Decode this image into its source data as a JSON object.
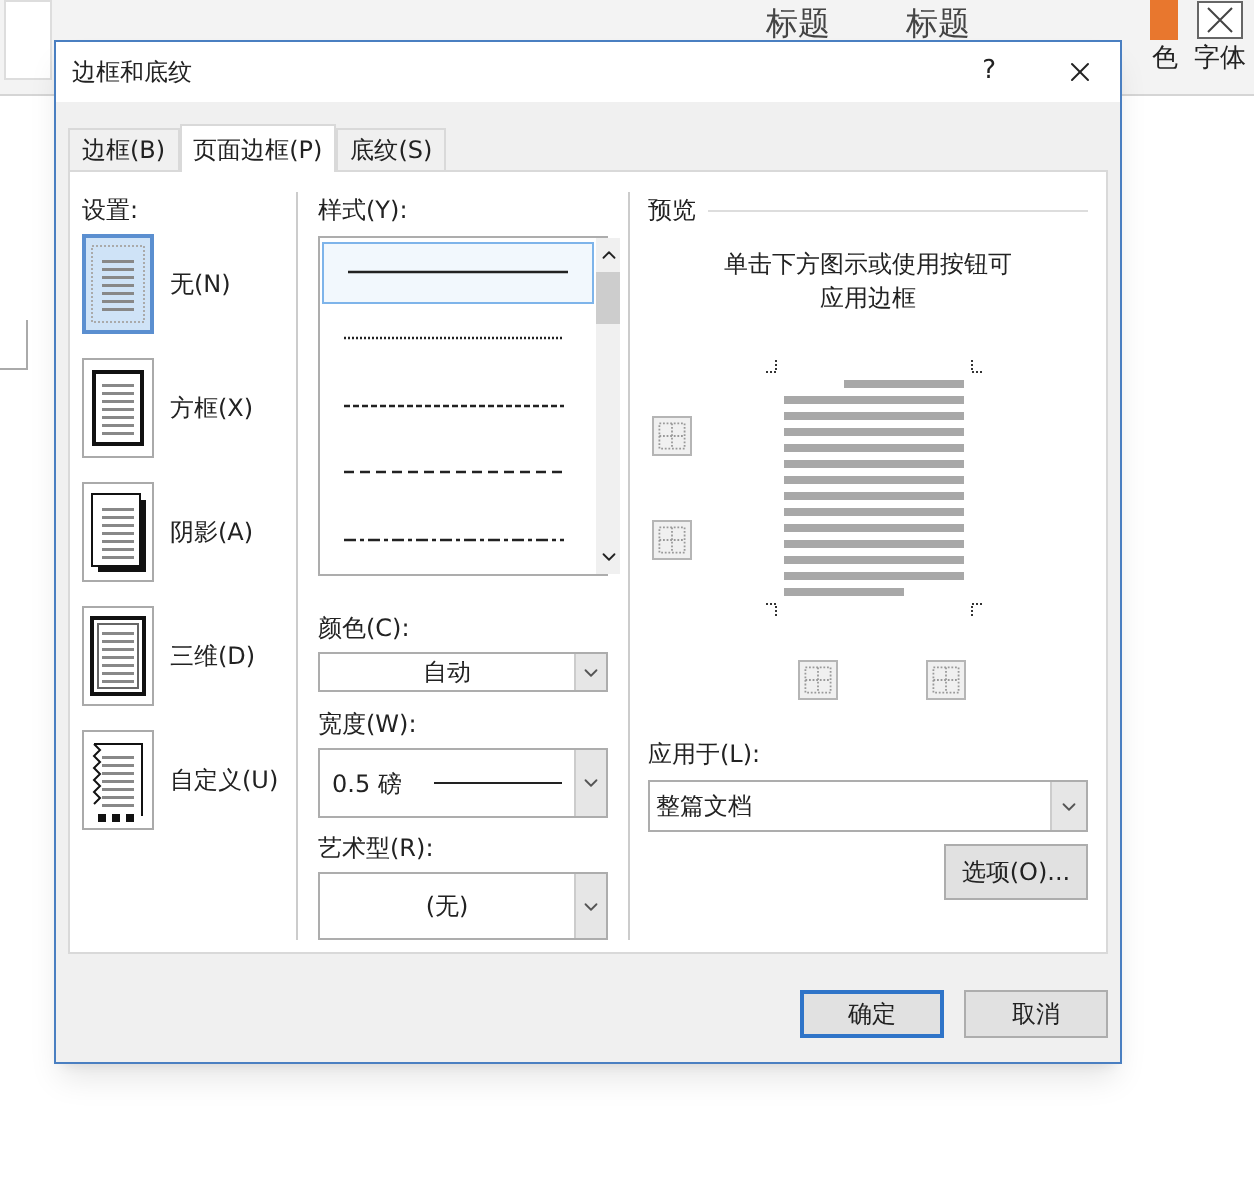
{
  "background": {
    "styles": [
      {
        "label": "标题"
      },
      {
        "label": "标题"
      }
    ],
    "color_button": {
      "label": "色"
    },
    "font_button": {
      "label": "字体"
    }
  },
  "dialog": {
    "title": "边框和底纹",
    "help": "?",
    "tabs": [
      {
        "label": "边框(B)",
        "selected": false
      },
      {
        "label": "页面边框(P)",
        "selected": true
      },
      {
        "label": "底纹(S)",
        "selected": false
      }
    ],
    "settings": {
      "label": "设置:",
      "items": [
        {
          "kind": "none",
          "label": "无(N)",
          "selected": true
        },
        {
          "kind": "box",
          "label": "方框(X)",
          "selected": false
        },
        {
          "kind": "shadow",
          "label": "阴影(A)",
          "selected": false
        },
        {
          "kind": "raised",
          "label": "三维(D)",
          "selected": false
        },
        {
          "kind": "custom",
          "label": "自定义(U)",
          "selected": false
        }
      ]
    },
    "style": {
      "label": "样式(Y):",
      "items": [
        {
          "kind": "solid",
          "selected": true
        },
        {
          "kind": "dotted",
          "selected": false
        },
        {
          "kind": "dashed",
          "selected": false
        },
        {
          "kind": "longdash",
          "selected": false
        },
        {
          "kind": "dashdot",
          "selected": false
        }
      ]
    },
    "color": {
      "label": "颜色(C):",
      "value": "自动"
    },
    "width": {
      "label": "宽度(W):",
      "value": "0.5 磅"
    },
    "art": {
      "label": "艺术型(R):",
      "value": "(无)"
    },
    "preview": {
      "label": "预览",
      "hint": [
        "单击下方图示或使用按钮可",
        "应用边框"
      ]
    },
    "apply_to": {
      "label": "应用于(L):",
      "value": "整篇文档"
    },
    "options_button": "选项(O)...",
    "ok_button": "确定",
    "cancel_button": "取消"
  }
}
